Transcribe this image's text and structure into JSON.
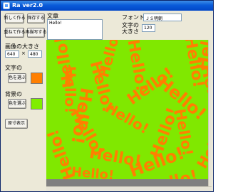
{
  "window": {
    "title": "Ra ver2.0"
  },
  "buttons": {
    "new": "新しく作る",
    "save": "保存する",
    "reset": "重ねて作る",
    "regen": "再描写する",
    "text_color": "色を選ぶ",
    "bg_color": "色を選ぶ",
    "actual_size": "原寸表示"
  },
  "text_section": {
    "label": "文章",
    "value": "Hello!"
  },
  "font": {
    "label": "フォント",
    "value": "ＪＳ明朝"
  },
  "char_size": {
    "label_line1": "文字の",
    "label_line2": "大きさ",
    "value": "120"
  },
  "image_size": {
    "label": "画像の大きさ",
    "width": "640",
    "separator": "×",
    "height": "480"
  },
  "text_color_section": {
    "label": "文字の",
    "color": "#ff7f00"
  },
  "bg_section": {
    "label": "背景の",
    "color": "#80ee00"
  },
  "canvas": {
    "background": "#80e800",
    "text_color": "#ff7f00",
    "words": [
      "Hello!",
      "Hello!",
      "Hello!",
      "Hello!",
      "Hello!",
      "Hello!",
      "Hello!",
      "Hello!",
      "Hello!",
      "Hello!",
      "Hello!",
      "Hello!",
      "Hello!",
      "Hello!",
      "Hello!",
      "Hello!",
      "Hello!",
      "Hello!",
      "Hello!",
      "Hello!",
      "Hello!"
    ]
  }
}
